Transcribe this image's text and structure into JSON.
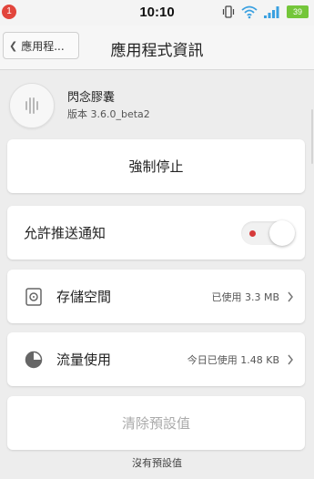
{
  "status_bar": {
    "notification_count": "1",
    "time": "10:10",
    "battery_level": "39",
    "battery_color": "#74c63a",
    "icons": [
      "vibrate-icon",
      "wifi-icon",
      "signal-icon",
      "battery-icon"
    ]
  },
  "header": {
    "back_label": "應用程...",
    "title": "應用程式資訊"
  },
  "app": {
    "name": "閃念膠囊",
    "version": "版本 3.6.0_beta2",
    "icon": "app-capsule-icon"
  },
  "actions": {
    "force_stop": "強制停止",
    "clear_defaults": "清除預設值"
  },
  "notifications": {
    "label": "允許推送通知",
    "toggle_on": true,
    "toggle_dot_color": "#d63a3a"
  },
  "storage": {
    "label": "存儲空間",
    "value": "已使用 3.3 MB",
    "icon": "storage-icon"
  },
  "traffic": {
    "label": "流量使用",
    "value": "今日已使用 1.48 KB",
    "icon": "traffic-pie-icon"
  },
  "footer": {
    "note": "沒有預設值"
  }
}
